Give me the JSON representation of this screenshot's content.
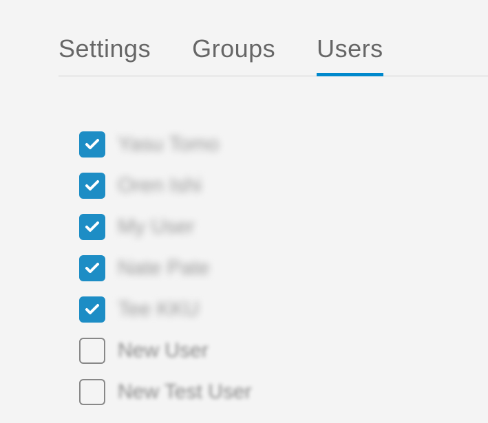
{
  "tabs": [
    {
      "label": "Settings",
      "active": false
    },
    {
      "label": "Groups",
      "active": false
    },
    {
      "label": "Users",
      "active": true
    }
  ],
  "users": [
    {
      "name": "Yasu Tomo",
      "checked": true
    },
    {
      "name": "Oren Ishi",
      "checked": true
    },
    {
      "name": "My User",
      "checked": true
    },
    {
      "name": "Nate Pate",
      "checked": true
    },
    {
      "name": "Tee KKU",
      "checked": true
    },
    {
      "name": "New User",
      "checked": false
    },
    {
      "name": "New Test User",
      "checked": false
    }
  ]
}
